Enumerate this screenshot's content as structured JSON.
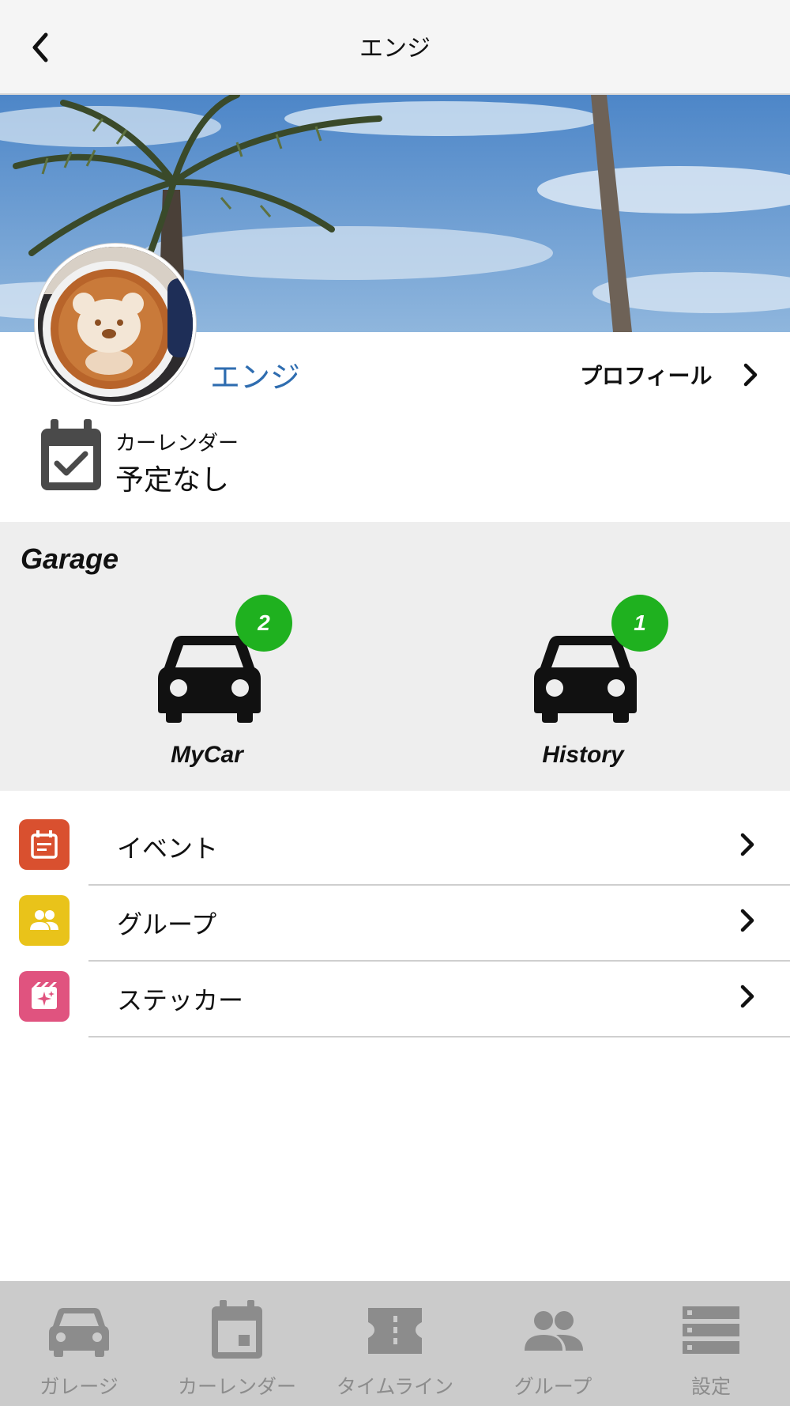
{
  "header": {
    "title": "エンジ",
    "back_icon": "chevron-left-icon"
  },
  "profile": {
    "name": "エンジ",
    "profile_link_label": "プロフィール",
    "calendar_label": "カーレンダー",
    "calendar_value": "予定なし"
  },
  "garage": {
    "title": "Garage",
    "items": [
      {
        "label": "MyCar",
        "badge": "2",
        "icon": "car-icon"
      },
      {
        "label": "History",
        "badge": "1",
        "icon": "car-icon"
      }
    ],
    "badge_color": "#1fb11f"
  },
  "menu": {
    "items": [
      {
        "label": "イベント",
        "icon": "event-icon",
        "color": "#d9502f"
      },
      {
        "label": "グループ",
        "icon": "group-icon",
        "color": "#e9c31a"
      },
      {
        "label": "ステッカー",
        "icon": "sticker-icon",
        "color": "#e0537f"
      }
    ]
  },
  "bottom_nav": {
    "items": [
      {
        "label": "ガレージ",
        "icon": "car-icon"
      },
      {
        "label": "カーレンダー",
        "icon": "calendar-icon"
      },
      {
        "label": "タイムライン",
        "icon": "ticket-icon"
      },
      {
        "label": "グループ",
        "icon": "group-icon"
      },
      {
        "label": "設定",
        "icon": "settings-list-icon"
      }
    ]
  },
  "colors": {
    "accent_name": "#2f6db0",
    "nav_bg": "#cbcbcb",
    "nav_text": "#8c8c8c"
  }
}
